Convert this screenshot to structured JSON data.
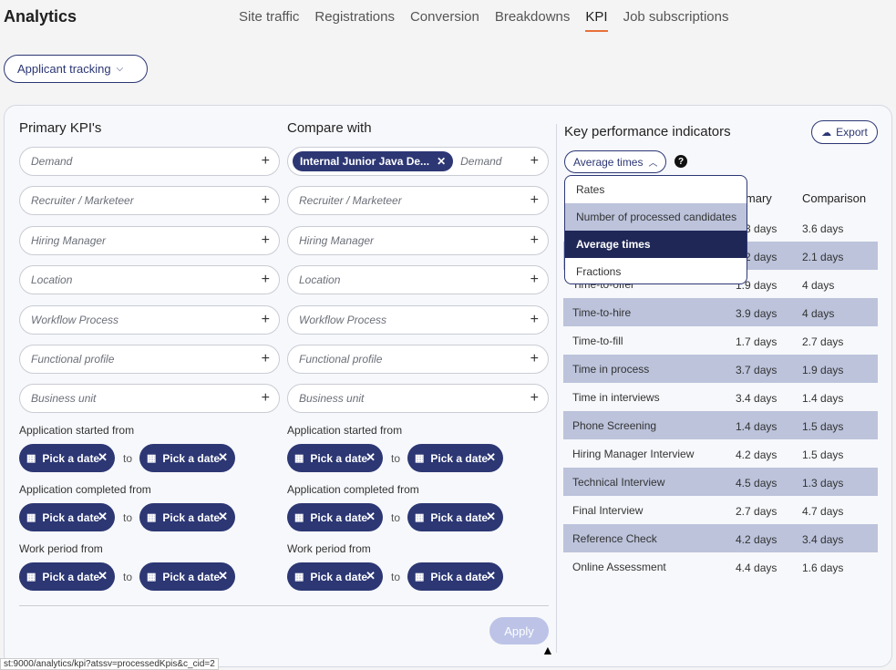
{
  "app": {
    "title": "Analytics"
  },
  "tabs": [
    "Site traffic",
    "Registrations",
    "Conversion",
    "Breakdowns",
    "KPI",
    "Job subscriptions"
  ],
  "active_tab": "KPI",
  "module_select": {
    "label": "Applicant tracking",
    "icon": "chevron-down-icon"
  },
  "primary": {
    "title": "Primary KPI's",
    "filters": [
      "Demand",
      "Recruiter / Marketeer",
      "Hiring Manager",
      "Location",
      "Workflow Process",
      "Functional profile",
      "Business unit"
    ]
  },
  "compare": {
    "title": "Compare with",
    "selected_chip": "Internal Junior Java De...",
    "filters": [
      "Demand",
      "Recruiter / Marketeer",
      "Hiring Manager",
      "Location",
      "Workflow Process",
      "Functional profile",
      "Business unit"
    ]
  },
  "date_ranges": {
    "labels": [
      "Application started from",
      "Application completed from",
      "Work period from"
    ],
    "button_label": "Pick a date",
    "to": "to"
  },
  "apply_label": "Apply",
  "kpi": {
    "title": "Key performance indicators",
    "export_label": "Export",
    "metric_select": "Average times",
    "help": "?",
    "columns": {
      "primary": "Primary",
      "comparison": "Comparison"
    },
    "dropdown_options": [
      "Rates",
      "Number of processed candidates",
      "Average times",
      "Fractions"
    ],
    "dropdown_selected": "Average times",
    "rows": [
      {
        "name": "",
        "primary": "3.3 days",
        "comparison": "3.6 days"
      },
      {
        "name": "",
        "primary": "2.2 days",
        "comparison": "2.1 days"
      },
      {
        "name": "Time-to-offer",
        "primary": "1.9 days",
        "comparison": "4 days"
      },
      {
        "name": "Time-to-hire",
        "primary": "3.9 days",
        "comparison": "4 days"
      },
      {
        "name": "Time-to-fill",
        "primary": "1.7 days",
        "comparison": "2.7 days"
      },
      {
        "name": "Time in process",
        "primary": "3.7 days",
        "comparison": "1.9 days"
      },
      {
        "name": "Time in interviews",
        "primary": "3.4 days",
        "comparison": "1.4 days"
      },
      {
        "name": "Phone Screening",
        "primary": "1.4 days",
        "comparison": "1.5 days"
      },
      {
        "name": "Hiring Manager Interview",
        "primary": "4.2 days",
        "comparison": "1.5 days"
      },
      {
        "name": "Technical Interview",
        "primary": "4.5 days",
        "comparison": "1.3 days"
      },
      {
        "name": "Final Interview",
        "primary": "2.7 days",
        "comparison": "4.7 days"
      },
      {
        "name": "Reference Check",
        "primary": "4.2 days",
        "comparison": "3.4 days"
      },
      {
        "name": "Online Assessment",
        "primary": "4.4 days",
        "comparison": "1.6 days"
      }
    ]
  },
  "statusbar": "st:9000/analytics/kpi?atssv=processedKpis&c_cid=2"
}
